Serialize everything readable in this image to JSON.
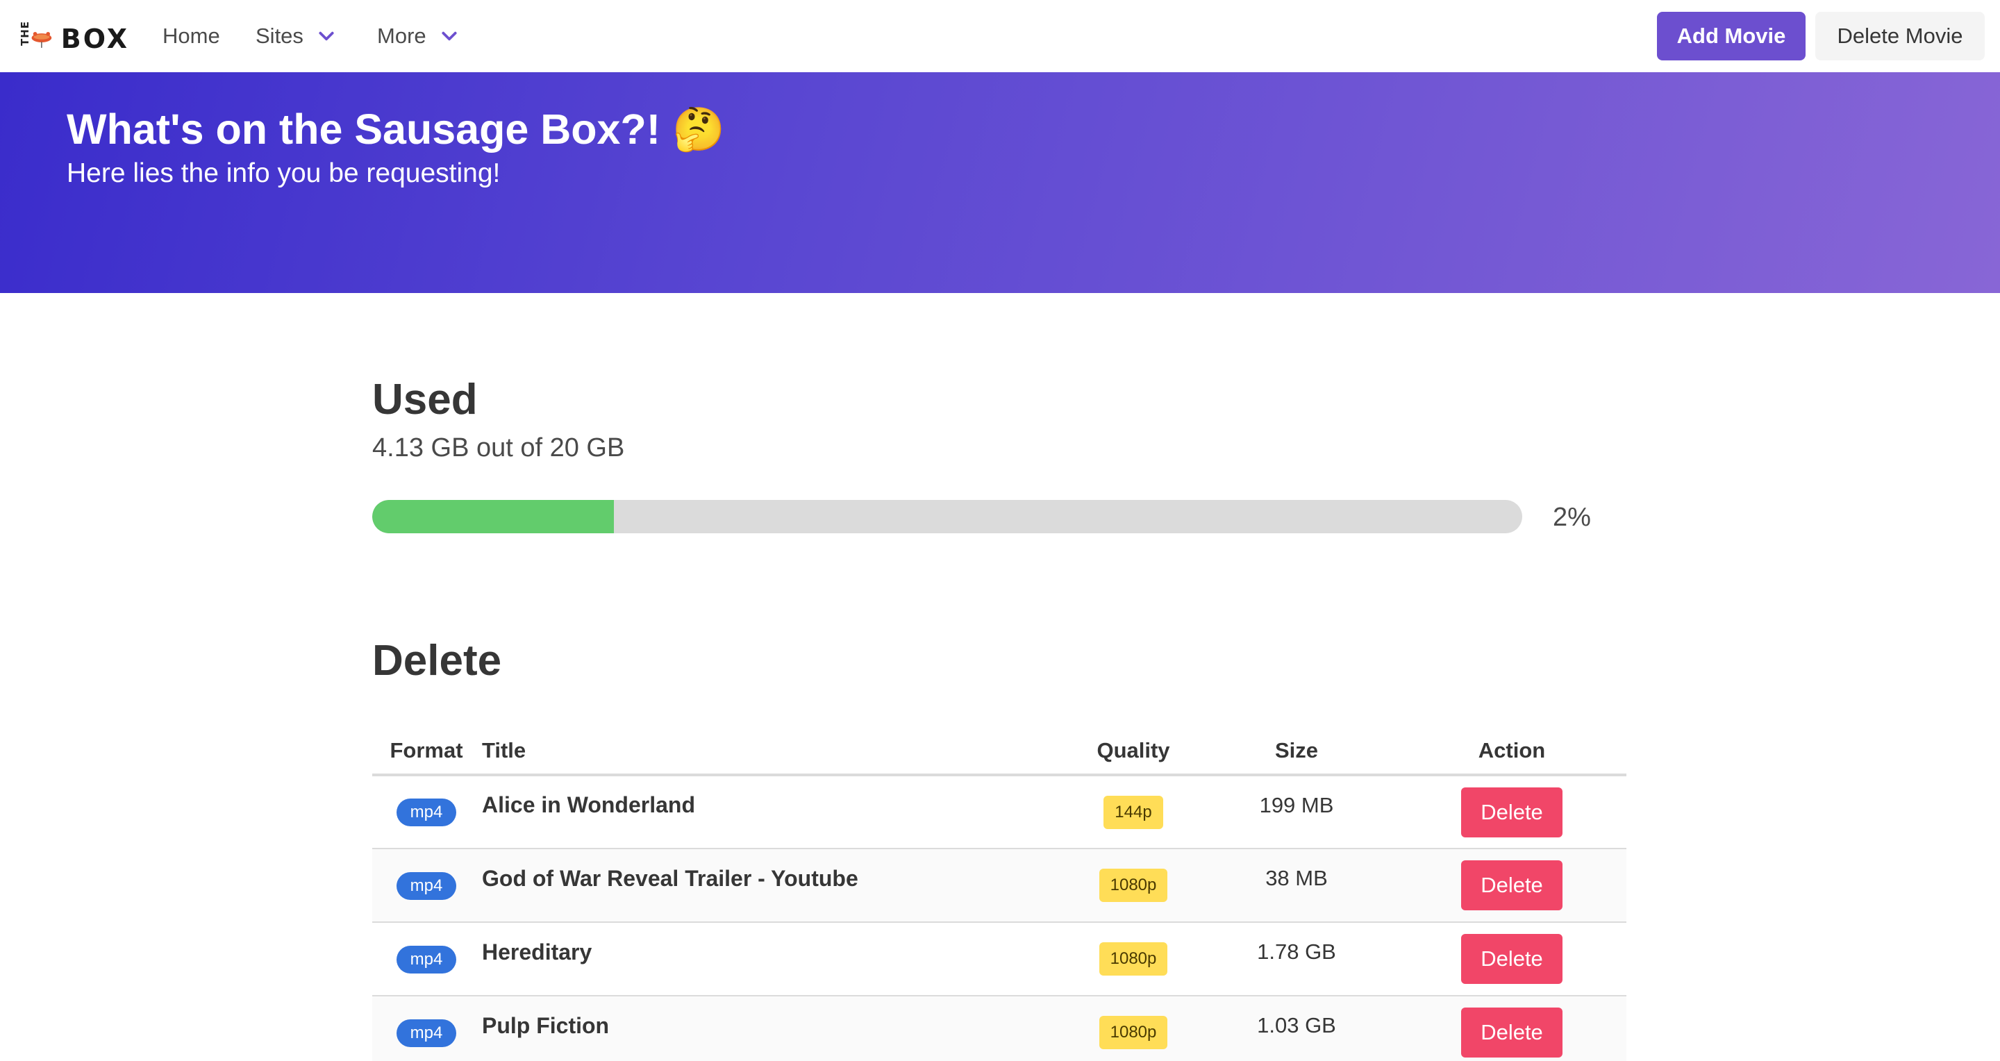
{
  "nav": {
    "logo_the": "THE",
    "logo_box": "BOX",
    "home": "Home",
    "sites": "Sites",
    "more": "More",
    "add_movie": "Add Movie",
    "delete_movie": "Delete Movie",
    "accent": "#6c4fcf"
  },
  "hero": {
    "title": "What's on the Sausage Box?! 🤔",
    "subtitle": "Here lies the info you be requesting!"
  },
  "usage": {
    "title": "Used",
    "summary": "4.13 GB out of 20 GB",
    "percent_label": "2%",
    "fill_fraction": 0.21,
    "fill_color": "#62cc6c"
  },
  "delete_section": {
    "title": "Delete",
    "columns": [
      "Format",
      "Title",
      "Quality",
      "Size",
      "Action"
    ],
    "rows": [
      {
        "format": "mp4",
        "title": "Alice in Wonderland",
        "quality": "144p",
        "size": "199 MB",
        "action": "Delete"
      },
      {
        "format": "mp4",
        "title": "God of War Reveal Trailer - Youtube",
        "quality": "1080p",
        "size": "38 MB",
        "action": "Delete"
      },
      {
        "format": "mp4",
        "title": "Hereditary",
        "quality": "1080p",
        "size": "1.78 GB",
        "action": "Delete"
      },
      {
        "format": "mp4",
        "title": "Pulp Fiction",
        "quality": "1080p",
        "size": "1.03 GB",
        "action": "Delete"
      }
    ]
  }
}
